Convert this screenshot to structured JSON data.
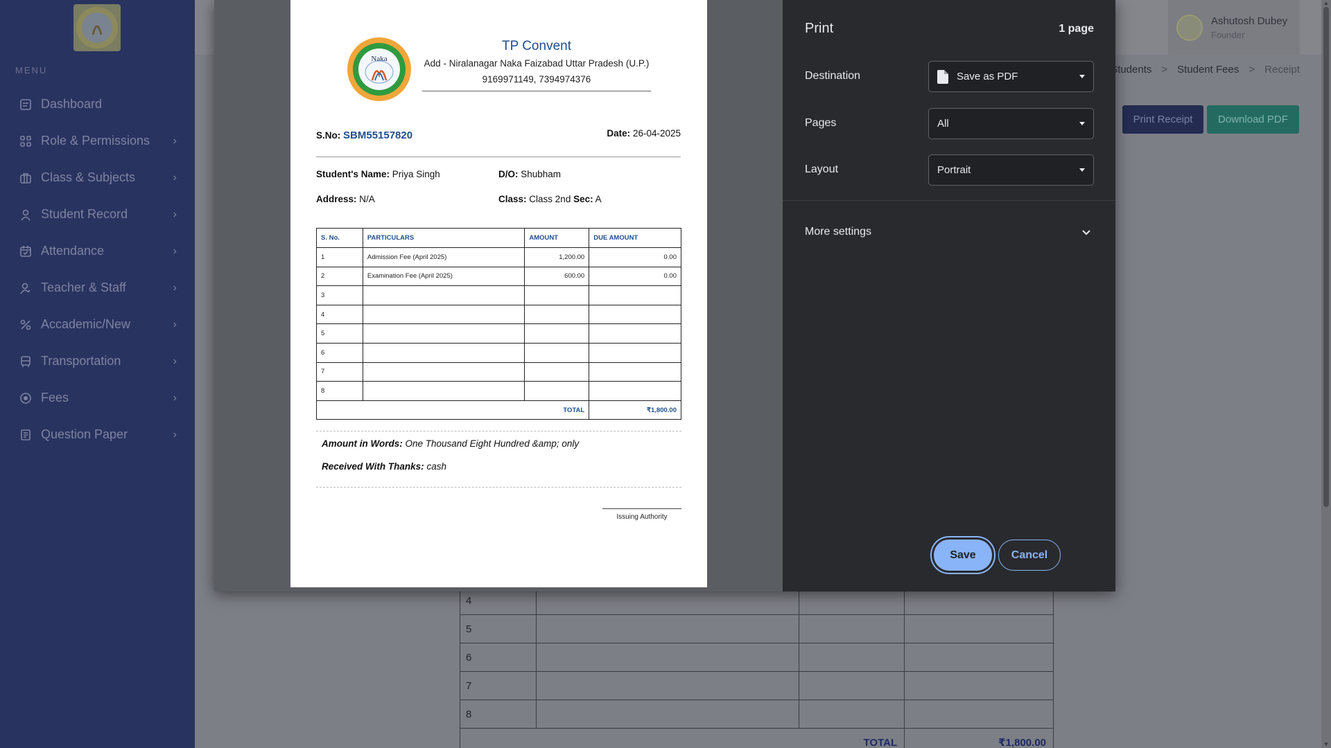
{
  "sidebar": {
    "menu_caption": "MENU",
    "items": [
      {
        "label": "Dashboard",
        "icon": "dashboard-icon",
        "has_chevron": false
      },
      {
        "label": "Role & Permissions",
        "icon": "grid-icon",
        "has_chevron": true
      },
      {
        "label": "Class & Subjects",
        "icon": "briefcase-icon",
        "has_chevron": true
      },
      {
        "label": "Student Record",
        "icon": "user-icon",
        "has_chevron": true
      },
      {
        "label": "Attendance",
        "icon": "calendar-icon",
        "has_chevron": true
      },
      {
        "label": "Teacher & Staff",
        "icon": "teacher-icon",
        "has_chevron": true
      },
      {
        "label": "Accademic/New",
        "icon": "percent-icon",
        "has_chevron": true
      },
      {
        "label": "Transportation",
        "icon": "bus-icon",
        "has_chevron": true
      },
      {
        "label": "Fees",
        "icon": "coin-icon",
        "has_chevron": true
      },
      {
        "label": "Question Paper",
        "icon": "document-icon",
        "has_chevron": true
      }
    ]
  },
  "header": {
    "user_name": "Ashutosh Dubey",
    "user_role": "Founder"
  },
  "breadcrumb": {
    "items": [
      "Students",
      "Student Fees",
      "Receipt"
    ],
    "separator": ">"
  },
  "page_actions": {
    "print_receipt": "Print Receipt",
    "download_pdf": "Download PDF"
  },
  "background_table": {
    "rows": [
      "4",
      "5",
      "6",
      "7",
      "8"
    ],
    "total_label": "TOTAL",
    "total_value": "₹1,800.00"
  },
  "receipt": {
    "school_name": "TP Convent",
    "logo_text": "Naka",
    "address": "Add - Niralanagar Naka Faizabad Uttar Pradesh (U.P.)",
    "phone": "9169971149, 7394974376",
    "sno_label": "S.No:",
    "sno_value": "SBM55157820",
    "date_label": "Date:",
    "date_value": "26-04-2025",
    "student_name_label": "Student's Name:",
    "student_name": "Priya Singh",
    "do_label": "D/O:",
    "do_value": "Shubham",
    "address_label": "Address:",
    "address_value": "N/A",
    "class_label": "Class:",
    "class_value": "Class 2nd",
    "sec_label": "Sec:",
    "sec_value": "A",
    "table": {
      "headers": [
        "S. No.",
        "PARTICULARS",
        "AMOUNT",
        "DUE AMOUNT"
      ],
      "rows": [
        [
          "1",
          "Admission Fee (April 2025)",
          "1,200.00",
          "0.00"
        ],
        [
          "2",
          "Examination Fee (April 2025)",
          "600.00",
          "0.00"
        ],
        [
          "3",
          "",
          "",
          ""
        ],
        [
          "4",
          "",
          "",
          ""
        ],
        [
          "5",
          "",
          "",
          ""
        ],
        [
          "6",
          "",
          "",
          ""
        ],
        [
          "7",
          "",
          "",
          ""
        ],
        [
          "8",
          "",
          "",
          ""
        ]
      ],
      "total_label": "TOTAL",
      "total_value": "₹1,800.00"
    },
    "words_label": "Amount in Words:",
    "words_value": "One Thousand Eight Hundred &amp; only",
    "received_label": "Received With Thanks:",
    "received_value": "cash",
    "signature_label": "Issuing Authority"
  },
  "print_dialog": {
    "title": "Print",
    "page_count": "1 page",
    "destination_label": "Destination",
    "destination_value": "Save as PDF",
    "pages_label": "Pages",
    "pages_value": "All",
    "layout_label": "Layout",
    "layout_value": "Portrait",
    "more_settings": "More settings",
    "save": "Save",
    "cancel": "Cancel"
  },
  "colors": {
    "sidebar_bg": "#293360",
    "dialog_bg": "#292a2d",
    "accent_blue": "#8ab4f8",
    "receipt_blue": "#1d4f8f"
  }
}
